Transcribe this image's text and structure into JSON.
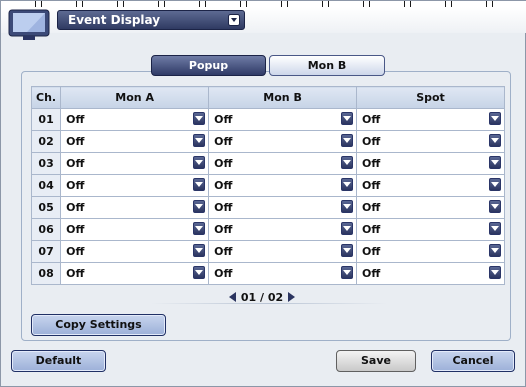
{
  "window": {
    "title": "Event Display"
  },
  "tabs": [
    {
      "label": "Popup",
      "active": true
    },
    {
      "label": "Mon B",
      "active": false
    }
  ],
  "table": {
    "headers": [
      "Ch.",
      "Mon A",
      "Mon B",
      "Spot"
    ],
    "rows": [
      {
        "ch": "01",
        "mon_a": "Off",
        "mon_b": "Off",
        "spot": "Off"
      },
      {
        "ch": "02",
        "mon_a": "Off",
        "mon_b": "Off",
        "spot": "Off"
      },
      {
        "ch": "03",
        "mon_a": "Off",
        "mon_b": "Off",
        "spot": "Off"
      },
      {
        "ch": "04",
        "mon_a": "Off",
        "mon_b": "Off",
        "spot": "Off"
      },
      {
        "ch": "05",
        "mon_a": "Off",
        "mon_b": "Off",
        "spot": "Off"
      },
      {
        "ch": "06",
        "mon_a": "Off",
        "mon_b": "Off",
        "spot": "Off"
      },
      {
        "ch": "07",
        "mon_a": "Off",
        "mon_b": "Off",
        "spot": "Off"
      },
      {
        "ch": "08",
        "mon_a": "Off",
        "mon_b": "Off",
        "spot": "Off"
      }
    ]
  },
  "pager": {
    "text": "01 / 02"
  },
  "buttons": {
    "copy_settings": "Copy Settings",
    "default": "Default",
    "save": "Save",
    "cancel": "Cancel"
  },
  "colors": {
    "accent_dark": "#2f3a62",
    "panel_bg": "#e9edf2",
    "header_bg": "#c6d3e6"
  }
}
